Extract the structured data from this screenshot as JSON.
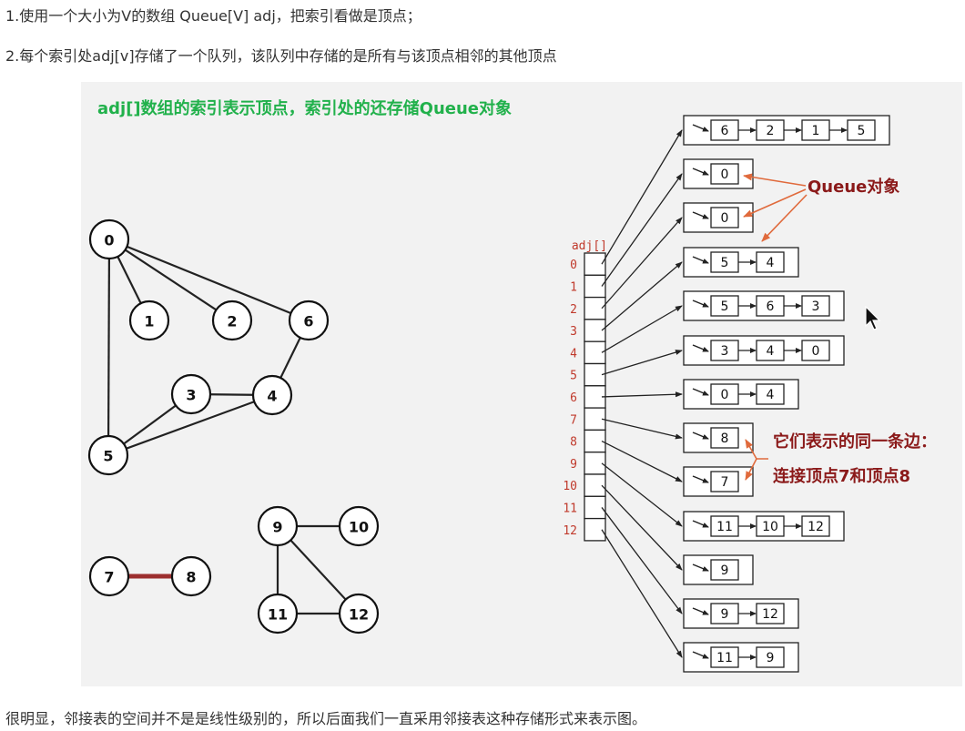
{
  "intro": {
    "line1": "1.使用一个大小为V的数组 Queue[V] adj，把索引看做是顶点；",
    "line2": "2.每个索引处adj[v]存储了一个队列，该队列中存储的是所有与该顶点相邻的其他顶点"
  },
  "figure": {
    "caption": "adj[]数组的索引表示顶点，索引处的还存储Queue对象",
    "array_label": "adj[]",
    "queue_annotation": "Queue对象",
    "edge_annotation_line1": "它们表示的同一条边：",
    "edge_annotation_line2": "连接顶点7和顶点8",
    "highlight_color": "#9c2f2f",
    "caption_color": "#21b14b",
    "annotation_color": "#8b1a1a",
    "annotation_arrow_color": "#e06a3c"
  },
  "graph": {
    "vertices": [
      "0",
      "1",
      "2",
      "3",
      "4",
      "5",
      "6",
      "7",
      "8",
      "9",
      "10",
      "11",
      "12"
    ],
    "edges": [
      [
        "0",
        "1"
      ],
      [
        "0",
        "2"
      ],
      [
        "0",
        "6"
      ],
      [
        "0",
        "5"
      ],
      [
        "6",
        "4"
      ],
      [
        "3",
        "4"
      ],
      [
        "3",
        "5"
      ],
      [
        "4",
        "5"
      ],
      [
        "7",
        "8"
      ],
      [
        "9",
        "10"
      ],
      [
        "9",
        "11"
      ],
      [
        "9",
        "12"
      ],
      [
        "11",
        "12"
      ]
    ],
    "highlighted_edge": [
      "7",
      "8"
    ]
  },
  "adjacency": {
    "indices": [
      "0",
      "1",
      "2",
      "3",
      "4",
      "5",
      "6",
      "7",
      "8",
      "9",
      "10",
      "11",
      "12"
    ],
    "lists": [
      [
        "6",
        "2",
        "1",
        "5"
      ],
      [
        "0"
      ],
      [
        "0"
      ],
      [
        "5",
        "4"
      ],
      [
        "5",
        "6",
        "3"
      ],
      [
        "3",
        "4",
        "0"
      ],
      [
        "0",
        "4"
      ],
      [
        "8"
      ],
      [
        "7"
      ],
      [
        "11",
        "10",
        "12"
      ],
      [
        "9"
      ],
      [
        "9",
        "12"
      ],
      [
        "11",
        "9"
      ]
    ]
  },
  "outro": "很明显，邻接表的空间并不是是线性级别的，所以后面我们一直采用邻接表这种存储形式来表示图。"
}
